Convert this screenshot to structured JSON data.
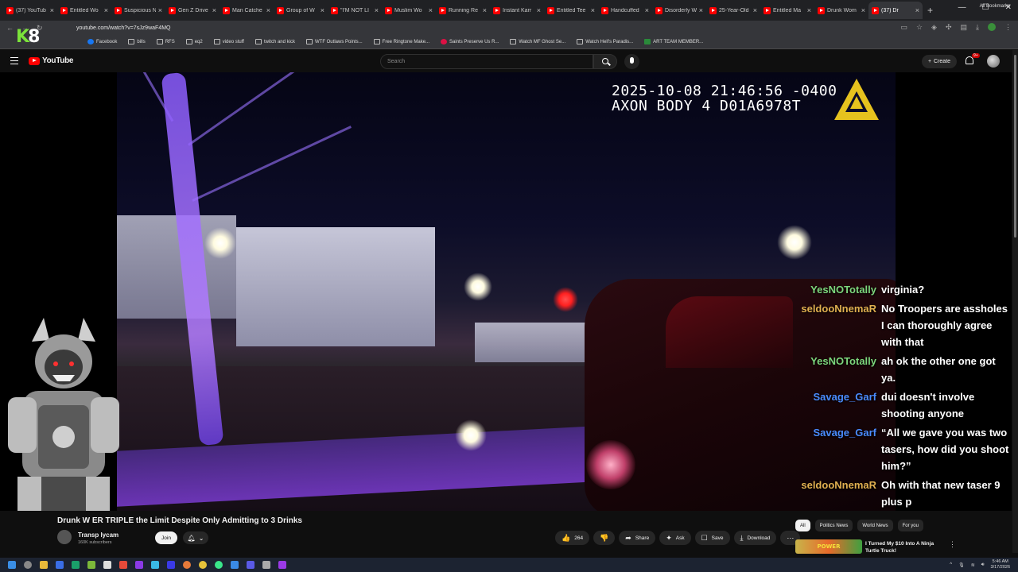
{
  "browser": {
    "tabs": [
      {
        "label": "(37) YouTub"
      },
      {
        "label": "Entitled Wo"
      },
      {
        "label": "Suspicious N"
      },
      {
        "label": "Gen Z Drive"
      },
      {
        "label": "Man Catche"
      },
      {
        "label": "Group of W"
      },
      {
        "label": "\"I'M NOT LI"
      },
      {
        "label": "Muslim Wo"
      },
      {
        "label": "Running Re"
      },
      {
        "label": "Instant Karr"
      },
      {
        "label": "Entitled Tee"
      },
      {
        "label": "Handcuffed"
      },
      {
        "label": "Disorderly W"
      },
      {
        "label": "25-Year-Old"
      },
      {
        "label": "Entitled Ma"
      },
      {
        "label": "Drunk Wom"
      },
      {
        "label": "(37) Dr"
      }
    ],
    "active_tab_index": 16,
    "new_tab_symbol": "+",
    "url": "youtube.com/watch?v=7sJz9waF4MQ",
    "bookmarks": [
      {
        "label": "Facebook",
        "icon": "facebook-icon"
      },
      {
        "label": "bills",
        "icon": "folder-icon"
      },
      {
        "label": "RFS",
        "icon": "folder-icon"
      },
      {
        "label": "eq2",
        "icon": "folder-icon"
      },
      {
        "label": "video stuff",
        "icon": "folder-icon"
      },
      {
        "label": "twitch and kick",
        "icon": "folder-icon"
      },
      {
        "label": "WTF Outlaws Points...",
        "icon": "link-icon"
      },
      {
        "label": "Free Ringtone Make...",
        "icon": "link-icon"
      },
      {
        "label": "Saints Preserve Us R...",
        "icon": "link-icon"
      },
      {
        "label": "Watch MF Ghost Se...",
        "icon": "link-icon"
      },
      {
        "label": "Watch Hell's Paradis...",
        "icon": "link-icon"
      },
      {
        "label": "ART TEAM MEMBER...",
        "icon": "link-icon"
      }
    ],
    "all_bookmarks_label": "All Bookmarks",
    "overlay_logo": "K8"
  },
  "youtube": {
    "logo_text": "YouTube",
    "search_placeholder": "Search",
    "create_label": "Create",
    "notification_badge": "9+"
  },
  "video": {
    "timestamp_line1": "2025-10-08 21:46:56 -0400",
    "timestamp_line2": "AXON BODY 4 D01A6978T",
    "chat": [
      {
        "user": "YesNOTotally",
        "text": "virginia?",
        "color": "#7cd67c"
      },
      {
        "user": "seldooNnemaR",
        "text": "No Troopers are assholes I can thoroughly agree with that",
        "color": "#e0b050"
      },
      {
        "user": "YesNOTotally",
        "text": "ah ok the other one got ya.",
        "color": "#7cd67c"
      },
      {
        "user": "Savage_Garf",
        "text": "dui doesn't involve shooting anyone",
        "color": "#4a8cff"
      },
      {
        "user": "Savage_Garf",
        "text": "“All we gave you was two tasers, how did you shoot him?”",
        "color": "#4a8cff"
      },
      {
        "user": "seldooNnemaR",
        "text": "Oh with that new taser 9 plus p",
        "color": "#e0b050"
      }
    ]
  },
  "below_video": {
    "title": "Drunk W          ER TRIPLE the Limit Despite Only Admitting to 3 Drinks",
    "channel_name": "Transp          lycam",
    "subscribers": "160K subscribers",
    "join_label": "Join",
    "actions": [
      {
        "label": "264",
        "icon": "thumbs-up-icon",
        "glyph": "👍"
      },
      {
        "label": "",
        "icon": "thumbs-down-icon",
        "glyph": "👎"
      },
      {
        "label": "Share",
        "icon": "share-icon",
        "glyph": "➦"
      },
      {
        "label": "Ask",
        "icon": "sparkle-icon",
        "glyph": "✦"
      },
      {
        "label": "Save",
        "icon": "bookmark-icon",
        "glyph": "☐"
      },
      {
        "label": "Download",
        "icon": "download-icon",
        "glyph": "⤓"
      },
      {
        "label": "",
        "icon": "more-icon",
        "glyph": "⋯"
      }
    ],
    "chips": [
      "All",
      "Politics News",
      "World News",
      "For you"
    ],
    "recommendation": {
      "thumb_text": "POWER",
      "title": "I Turned My $10 Into A Ninja Turtle Truck!"
    }
  },
  "taskbar": {
    "time": "5:46 AM",
    "date": "3/17/2026"
  },
  "colors": {
    "youtube_red": "#ff0000",
    "background": "#0f0f0f",
    "axon_yellow": "#e6c21e"
  }
}
